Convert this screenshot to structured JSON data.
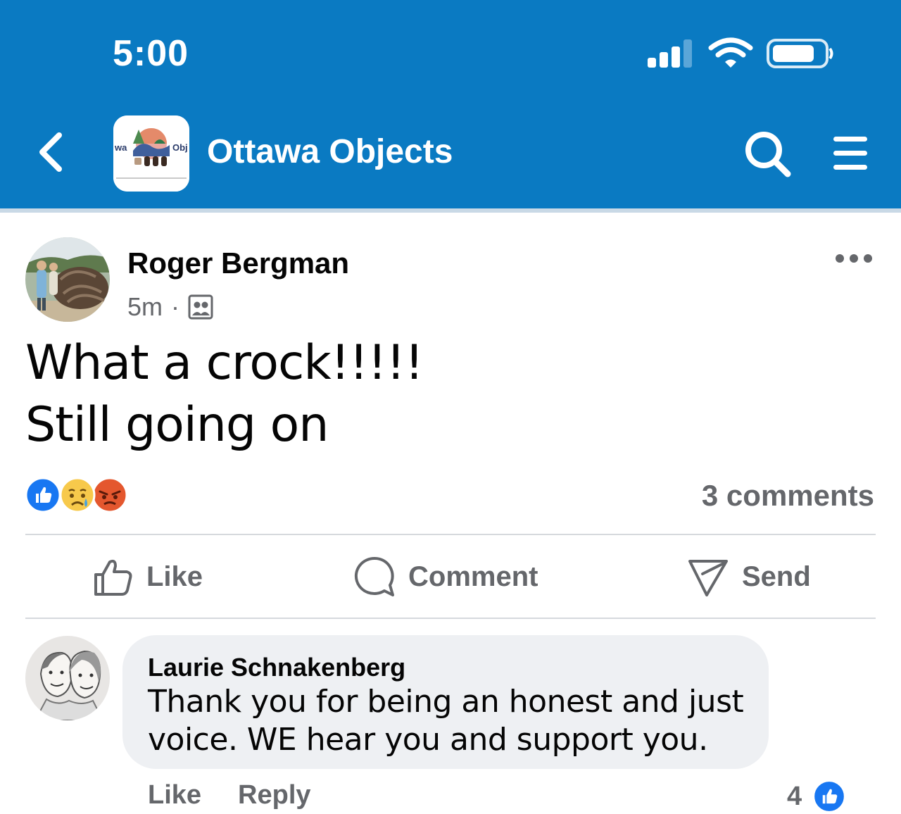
{
  "status_bar": {
    "time": "5:00"
  },
  "header": {
    "back_icon": "chevron-left-icon",
    "title": "Ottawa Objects",
    "logo_left_text": "wa",
    "logo_right_text": "Obj",
    "search_icon": "search-icon",
    "menu_icon": "hamburger-menu-icon"
  },
  "post": {
    "author": "Roger Bergman",
    "time": "5m",
    "separator": "·",
    "audience_icon": "group-members-icon",
    "text_lines": [
      "What a crock!!!!!",
      "Still going on"
    ],
    "reactions": [
      "like",
      "sad",
      "angry"
    ],
    "comments_label": "3 comments",
    "actions": {
      "like": "Like",
      "comment": "Comment",
      "send": "Send"
    }
  },
  "comment": {
    "author": "Laurie Schnakenberg",
    "text_lines": [
      "Thank you for being an honest and just",
      "voice. WE hear you and support you."
    ],
    "like_label": "Like",
    "reply_label": "Reply",
    "like_count": "4"
  },
  "colors": {
    "header_bg": "#0a7ac2",
    "like_blue": "#1877f2",
    "muted_text": "#65676b",
    "bubble_bg": "#eef0f3"
  }
}
